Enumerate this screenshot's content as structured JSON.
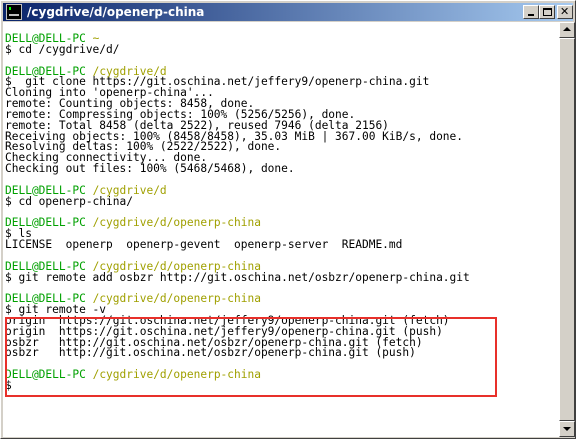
{
  "window": {
    "title": "/cygdrive/d/openerp-china"
  },
  "colors": {
    "prompt_user": "#00a000",
    "prompt_path": "#a0a000",
    "highlight_border": "#e8302a",
    "title_bar": "#0a246a"
  },
  "terminal": {
    "lines": [
      {
        "type": "prompt",
        "user": "DELL@DELL-PC",
        "path": "~"
      },
      {
        "type": "text",
        "text": "$ cd /cygdrive/d/"
      },
      {
        "type": "blank",
        "text": ""
      },
      {
        "type": "prompt",
        "user": "DELL@DELL-PC",
        "path": "/cygdrive/d"
      },
      {
        "type": "text",
        "text": "$  git clone https://git.oschina.net/jeffery9/openerp-china.git"
      },
      {
        "type": "text",
        "text": "Cloning into 'openerp-china'..."
      },
      {
        "type": "text",
        "text": "remote: Counting objects: 8458, done."
      },
      {
        "type": "text",
        "text": "remote: Compressing objects: 100% (5256/5256), done."
      },
      {
        "type": "text",
        "text": "remote: Total 8458 (delta 2522), reused 7946 (delta 2156)"
      },
      {
        "type": "text",
        "text": "Receiving objects: 100% (8458/8458), 35.03 MiB | 367.00 KiB/s, done."
      },
      {
        "type": "text",
        "text": "Resolving deltas: 100% (2522/2522), done."
      },
      {
        "type": "text",
        "text": "Checking connectivity... done."
      },
      {
        "type": "text",
        "text": "Checking out files: 100% (5468/5468), done."
      },
      {
        "type": "blank",
        "text": ""
      },
      {
        "type": "prompt",
        "user": "DELL@DELL-PC",
        "path": "/cygdrive/d"
      },
      {
        "type": "text",
        "text": "$ cd openerp-china/"
      },
      {
        "type": "blank",
        "text": ""
      },
      {
        "type": "prompt",
        "user": "DELL@DELL-PC",
        "path": "/cygdrive/d/openerp-china"
      },
      {
        "type": "text",
        "text": "$ ls"
      },
      {
        "type": "text",
        "text": "LICENSE  openerp  openerp-gevent  openerp-server  README.md"
      },
      {
        "type": "blank",
        "text": ""
      },
      {
        "type": "prompt",
        "user": "DELL@DELL-PC",
        "path": "/cygdrive/d/openerp-china"
      },
      {
        "type": "text",
        "text": "$ git remote add osbzr http://git.oschina.net/osbzr/openerp-china.git"
      },
      {
        "type": "blank",
        "text": ""
      },
      {
        "type": "prompt",
        "user": "DELL@DELL-PC",
        "path": "/cygdrive/d/openerp-china"
      },
      {
        "type": "text",
        "text": "$ git remote -v"
      },
      {
        "type": "text",
        "text": "origin  https://git.oschina.net/jeffery9/openerp-china.git (fetch)"
      },
      {
        "type": "text",
        "text": "origin  https://git.oschina.net/jeffery9/openerp-china.git (push)"
      },
      {
        "type": "text",
        "text": "osbzr   http://git.oschina.net/osbzr/openerp-china.git (fetch)"
      },
      {
        "type": "text",
        "text": "osbzr   http://git.oschina.net/osbzr/openerp-china.git (push)"
      },
      {
        "type": "blank",
        "text": ""
      },
      {
        "type": "prompt",
        "user": "DELL@DELL-PC",
        "path": "/cygdrive/d/openerp-china"
      },
      {
        "type": "text",
        "text": "$"
      }
    ]
  }
}
